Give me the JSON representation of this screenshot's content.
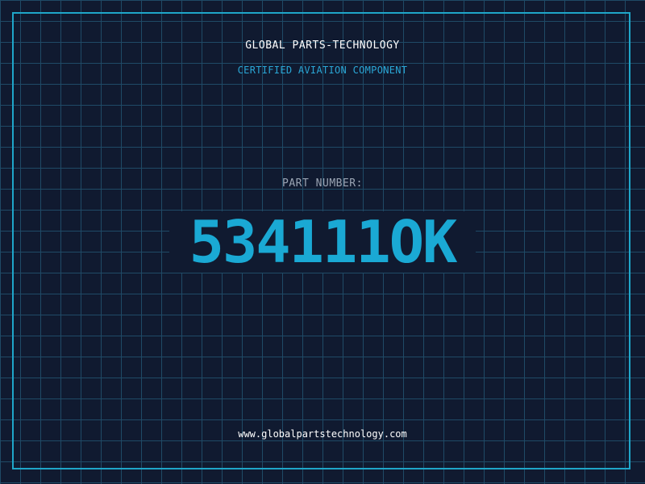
{
  "header": {
    "company": "GLOBAL PARTS-TECHNOLOGY",
    "tagline": "CERTIFIED AVIATION COMPONENT"
  },
  "part": {
    "label": "PART NUMBER:",
    "number": "534111OK"
  },
  "footer": {
    "url": "www.globalpartstechnology.com"
  },
  "colors": {
    "background": "#101a30",
    "grid": "#1f4a66",
    "frame": "#1fa6c9",
    "accent": "#1aa9d4"
  }
}
